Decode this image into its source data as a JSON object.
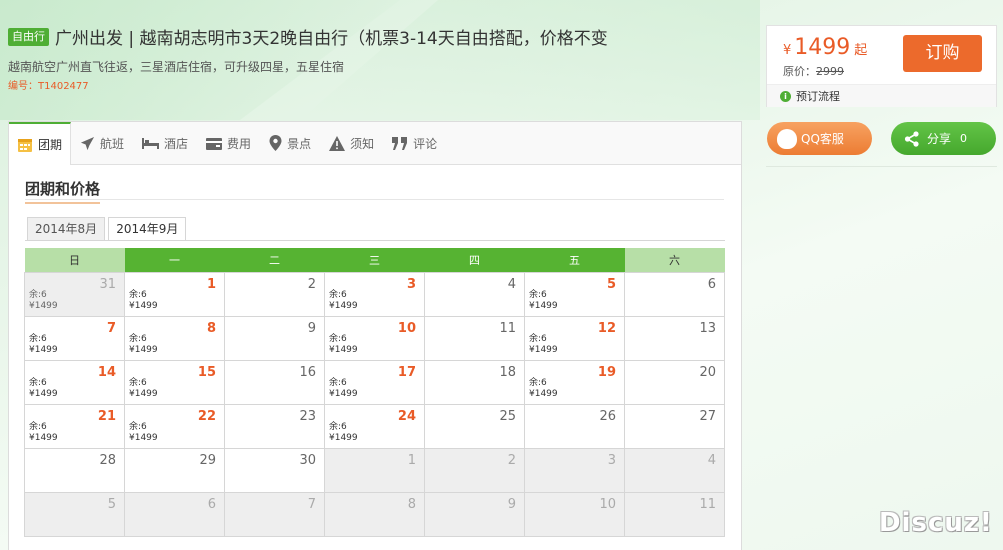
{
  "header": {
    "tag": "自由行",
    "title": "广州出发 | 越南胡志明市3天2晚自由行（机票3-14天自由搭配，价格不变",
    "subtitle": "越南航空广州直飞往返，三星酒店住宿，可升级四星，五星住宿",
    "code": "编号：T1402477"
  },
  "price_box": {
    "currency": "¥",
    "price": "1499",
    "suffix": "起",
    "original_label": "原价：",
    "original_price": "2999",
    "buy_label": "订购",
    "flow_label": "预订流程"
  },
  "side": {
    "qq_label": "QQ客服",
    "share_label": "分享",
    "share_count": "0"
  },
  "tabs": [
    {
      "label": "团期",
      "icon": "calendar-icon"
    },
    {
      "label": "航班",
      "icon": "plane-icon"
    },
    {
      "label": "酒店",
      "icon": "bed-icon"
    },
    {
      "label": "费用",
      "icon": "wallet-icon"
    },
    {
      "label": "景点",
      "icon": "location-pin-icon"
    },
    {
      "label": "须知",
      "icon": "warning-icon"
    },
    {
      "label": "评论",
      "icon": "quote-icon"
    }
  ],
  "section_title": "团期和价格",
  "month_tabs": [
    "2014年8月",
    "2014年9月"
  ],
  "active_month": 1,
  "calendar": {
    "weekdays": [
      "日",
      "一",
      "二",
      "三",
      "四",
      "五",
      "六"
    ],
    "weeks": [
      [
        {
          "day": "31",
          "state": "past",
          "remain": "余:6",
          "price": "¥1499"
        },
        {
          "day": "1",
          "state": "avail",
          "remain": "余:6",
          "price": "¥1499"
        },
        {
          "day": "2",
          "state": "normal"
        },
        {
          "day": "3",
          "state": "avail",
          "remain": "余:6",
          "price": "¥1499"
        },
        {
          "day": "4",
          "state": "normal"
        },
        {
          "day": "5",
          "state": "avail",
          "remain": "余:6",
          "price": "¥1499"
        },
        {
          "day": "6",
          "state": "normal"
        }
      ],
      [
        {
          "day": "7",
          "state": "avail",
          "remain": "余:6",
          "price": "¥1499"
        },
        {
          "day": "8",
          "state": "avail",
          "remain": "余:6",
          "price": "¥1499"
        },
        {
          "day": "9",
          "state": "normal"
        },
        {
          "day": "10",
          "state": "avail",
          "remain": "余:6",
          "price": "¥1499"
        },
        {
          "day": "11",
          "state": "normal"
        },
        {
          "day": "12",
          "state": "avail",
          "remain": "余:6",
          "price": "¥1499"
        },
        {
          "day": "13",
          "state": "normal"
        }
      ],
      [
        {
          "day": "14",
          "state": "avail",
          "remain": "余:6",
          "price": "¥1499"
        },
        {
          "day": "15",
          "state": "avail",
          "remain": "余:6",
          "price": "¥1499"
        },
        {
          "day": "16",
          "state": "normal"
        },
        {
          "day": "17",
          "state": "avail",
          "remain": "余:6",
          "price": "¥1499"
        },
        {
          "day": "18",
          "state": "normal"
        },
        {
          "day": "19",
          "state": "avail",
          "remain": "余:6",
          "price": "¥1499"
        },
        {
          "day": "20",
          "state": "normal"
        }
      ],
      [
        {
          "day": "21",
          "state": "avail",
          "remain": "余:6",
          "price": "¥1499"
        },
        {
          "day": "22",
          "state": "avail",
          "remain": "余:6",
          "price": "¥1499"
        },
        {
          "day": "23",
          "state": "normal"
        },
        {
          "day": "24",
          "state": "avail",
          "remain": "余:6",
          "price": "¥1499"
        },
        {
          "day": "25",
          "state": "normal"
        },
        {
          "day": "26",
          "state": "normal"
        },
        {
          "day": "27",
          "state": "normal"
        }
      ],
      [
        {
          "day": "28",
          "state": "normal"
        },
        {
          "day": "29",
          "state": "normal"
        },
        {
          "day": "30",
          "state": "normal"
        },
        {
          "day": "1",
          "state": "next"
        },
        {
          "day": "2",
          "state": "next"
        },
        {
          "day": "3",
          "state": "next"
        },
        {
          "day": "4",
          "state": "next"
        }
      ],
      [
        {
          "day": "5",
          "state": "next"
        },
        {
          "day": "6",
          "state": "next"
        },
        {
          "day": "7",
          "state": "next"
        },
        {
          "day": "8",
          "state": "next"
        },
        {
          "day": "9",
          "state": "next"
        },
        {
          "day": "10",
          "state": "next"
        },
        {
          "day": "11",
          "state": "next"
        }
      ]
    ]
  },
  "watermark": "Discuz!",
  "colors": {
    "accent": "#4fae35",
    "orange": "#e95b27",
    "buy": "#ec6a2c",
    "qq": "#ec7c33",
    "share": "#45a82d"
  }
}
